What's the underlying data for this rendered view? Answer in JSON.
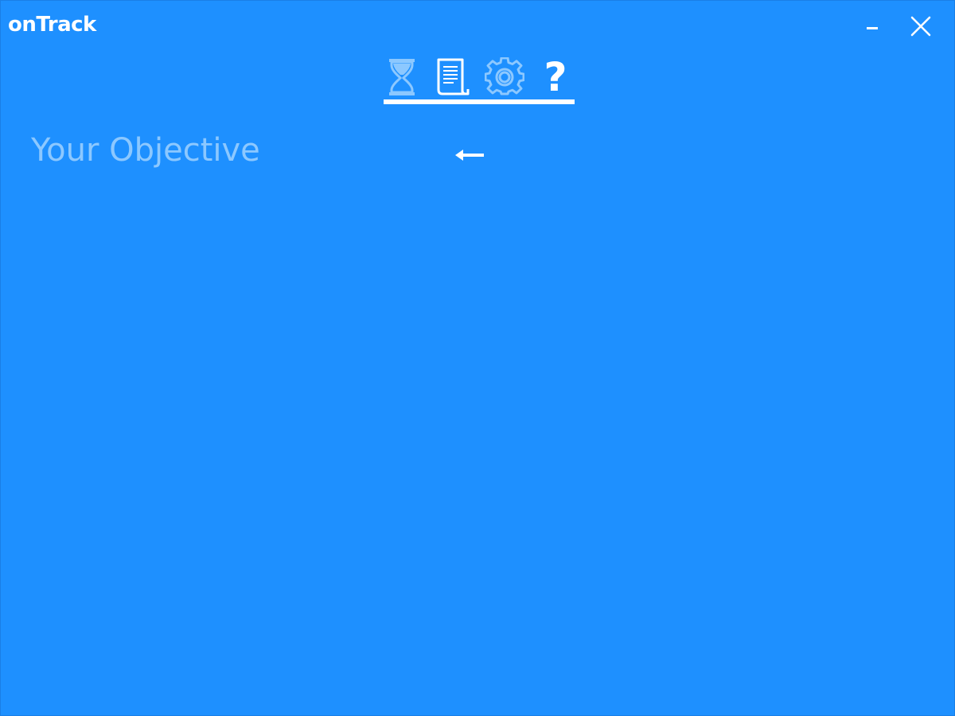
{
  "window": {
    "title": "onTrack",
    "minimize_icon": "minimize-icon",
    "close_icon": "close-icon"
  },
  "toolbar": {
    "items": [
      {
        "icon": "hourglass-icon",
        "name": "timer"
      },
      {
        "icon": "document-icon",
        "name": "log"
      },
      {
        "icon": "gear-icon",
        "name": "settings"
      },
      {
        "icon": "question-mark-icon",
        "name": "help",
        "glyph": "?"
      }
    ],
    "active_index": 1
  },
  "main": {
    "objective_placeholder": "Your Objective",
    "back_icon": "arrow-left-icon"
  },
  "colors": {
    "background": "#1E90FF",
    "foreground": "#FFFFFF",
    "muted": "#8CC8FF"
  }
}
